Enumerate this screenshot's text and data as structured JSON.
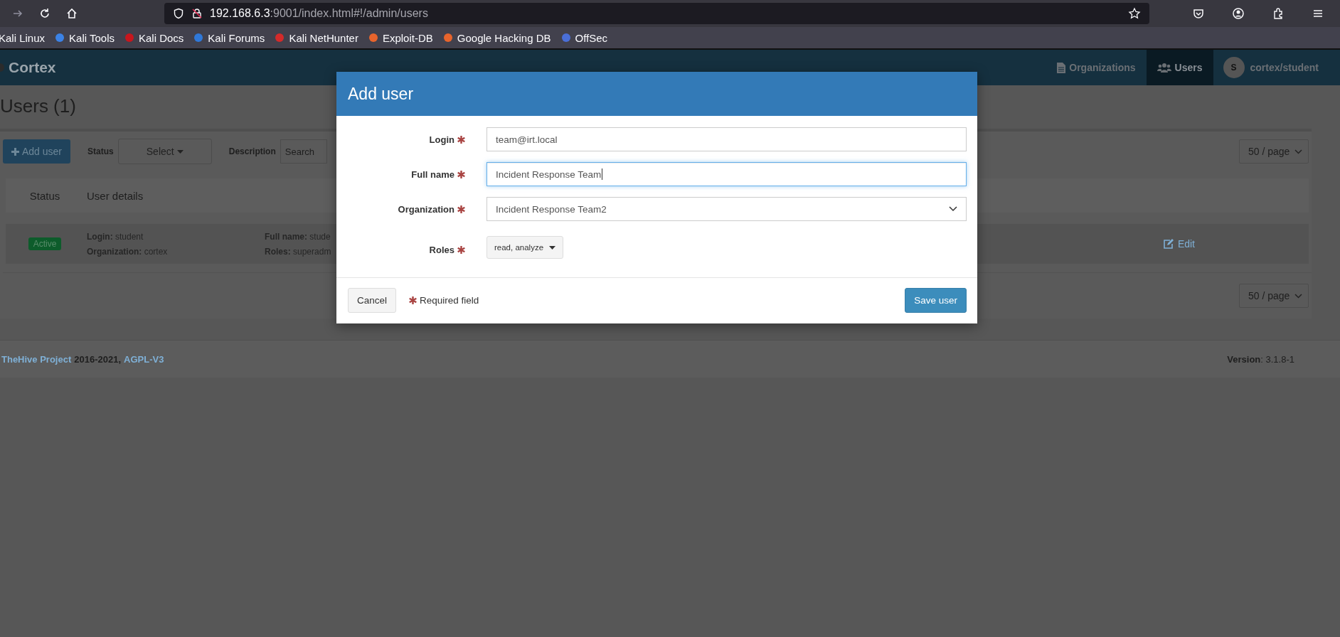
{
  "browser": {
    "url_host": "192.168.6.3",
    "url_rest": ":9001/index.html#!/admin/users"
  },
  "bookmarks": [
    {
      "label": "Kali Linux"
    },
    {
      "label": "Kali Tools",
      "color": "#3b82e6"
    },
    {
      "label": "Kali Docs",
      "color": "#c8161d"
    },
    {
      "label": "Kali Forums",
      "color": "#2f78d8"
    },
    {
      "label": "Kali NetHunter",
      "color": "#d42a2a"
    },
    {
      "label": "Exploit-DB",
      "color": "#e8642c"
    },
    {
      "label": "Google Hacking DB",
      "color": "#e8642c"
    },
    {
      "label": "OffSec",
      "color": "#4a6fd8"
    }
  ],
  "app": {
    "brand": "Cortex",
    "nav": [
      {
        "label": "Organizations",
        "kind": "file",
        "selected": false
      },
      {
        "label": "Users",
        "kind": "group",
        "selected": true
      }
    ],
    "user": {
      "initial": "S",
      "name": "cortex/student"
    }
  },
  "page": {
    "title": "Users (1)",
    "add_button": "Add user",
    "filters": [
      {
        "label": "Status",
        "kind": "select",
        "value": "Select"
      },
      {
        "label": "Description",
        "kind": "search",
        "placeholder": "Search"
      }
    ],
    "page_size_top": "50 / page",
    "page_size_bottom": "50 / page",
    "table": {
      "columns": [
        "Status",
        "User details"
      ],
      "rows": [
        {
          "status": "Active",
          "details": [
            {
              "label": "Login:",
              "value": "student"
            },
            {
              "label": "Organization:",
              "value": "cortex"
            },
            {
              "label": "Full name:",
              "value": "stude"
            },
            {
              "label": "Roles:",
              "value": "superadm"
            }
          ],
          "action": "Edit"
        }
      ]
    }
  },
  "footer": {
    "project": "TheHive Project",
    "years": "2016-2021,",
    "license": "AGPL-V3",
    "version": "**Version**: 3.1.8-1"
  },
  "modal": {
    "title": "Add user",
    "fields": [
      {
        "label": "Login",
        "required": true,
        "kind": "text",
        "value": "team@irt.local",
        "focused": false
      },
      {
        "label": "Full name",
        "required": true,
        "kind": "text",
        "value": "Incident Response Team",
        "focused": true
      },
      {
        "label": "Organization",
        "required": true,
        "kind": "select",
        "value": "Incident Response Team2",
        "focused": false
      },
      {
        "label": "Roles",
        "required": true,
        "kind": "multiselect",
        "value": "read, analyze",
        "focused": false
      }
    ],
    "cancel": "Cancel",
    "required_note": "Required field",
    "submit": "Save user"
  }
}
